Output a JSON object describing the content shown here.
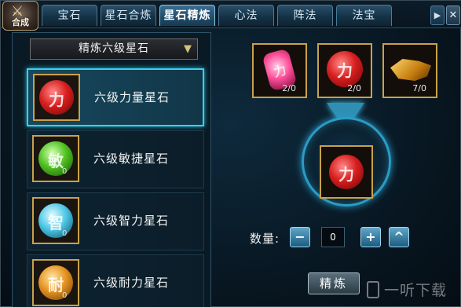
{
  "badge": {
    "label": "合成"
  },
  "tabs": [
    {
      "label": "宝石",
      "active": false
    },
    {
      "label": "星石合炼",
      "active": false
    },
    {
      "label": "星石精炼",
      "active": true
    },
    {
      "label": "心法",
      "active": false
    },
    {
      "label": "阵法",
      "active": false
    },
    {
      "label": "法宝",
      "active": false
    }
  ],
  "tab_scroll_icon": "chevron-right-icon",
  "close_icon": "close-icon",
  "dropdown": {
    "selected": "精炼六级星石"
  },
  "stone_list": [
    {
      "name": "六级力量星石",
      "color": "red",
      "glyph": "力",
      "count": "",
      "selected": true
    },
    {
      "name": "六级敏捷星石",
      "color": "green",
      "glyph": "敏",
      "count": "0",
      "selected": false
    },
    {
      "name": "六级智力星石",
      "color": "blue",
      "glyph": "智",
      "count": "0",
      "selected": false
    },
    {
      "name": "六级耐力星石",
      "color": "orange",
      "glyph": "耐",
      "count": "0",
      "selected": false
    }
  ],
  "materials": [
    {
      "count": "2/0"
    },
    {
      "count": "2/0"
    },
    {
      "count": "7/0"
    }
  ],
  "quantity": {
    "label": "数量:",
    "value": "0",
    "minus": "−",
    "plus": "+",
    "max": "^"
  },
  "refine_button": {
    "label": "精炼"
  },
  "watermark": {
    "text": "一听下载"
  },
  "colors": {
    "accent": "#3ad0ec",
    "gold_frame": "#c9a249"
  }
}
